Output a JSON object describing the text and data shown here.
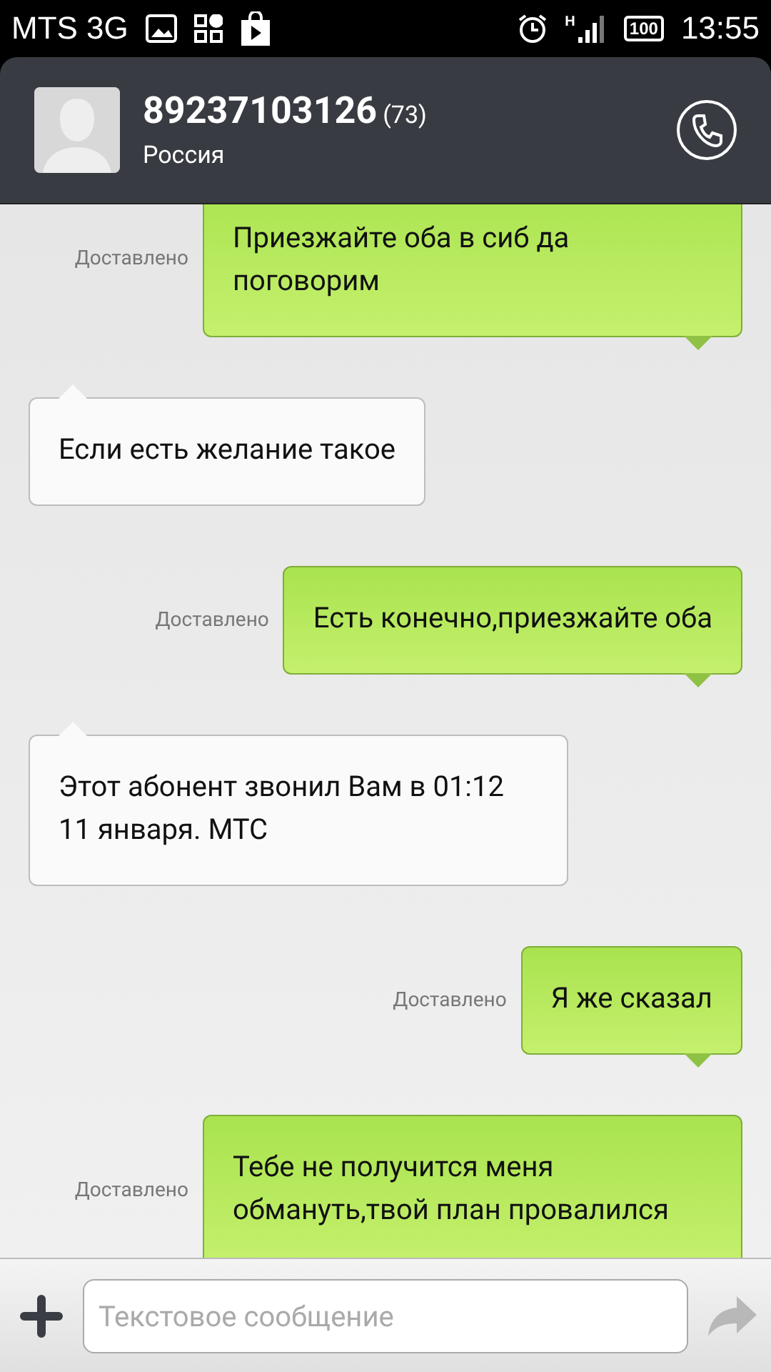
{
  "status_bar": {
    "carrier": "MTS 3G",
    "network_letter": "H",
    "battery": "100",
    "time": "13:55"
  },
  "header": {
    "name": "89237103126",
    "count": "(73)",
    "subtitle": "Россия"
  },
  "messages": [
    {
      "kind": "outgoing",
      "text": "Приезжайте оба в сиб да поговорим",
      "status": "Доставлено"
    },
    {
      "kind": "incoming",
      "text": "Если есть желание такое"
    },
    {
      "kind": "outgoing",
      "text": "Есть конечно,приезжайте оба",
      "status": "Доставлено"
    },
    {
      "kind": "incoming",
      "text": "Этот абонент звонил Вам в 01:12 11 января. МТС"
    },
    {
      "kind": "outgoing",
      "text": "Я же сказал",
      "status": "Доставлено"
    },
    {
      "kind": "outgoing",
      "text": "Тебе не получится меня обмануть,твой план провалился",
      "status": "Доставлено"
    }
  ],
  "compose": {
    "placeholder": "Текстовое сообщение"
  }
}
